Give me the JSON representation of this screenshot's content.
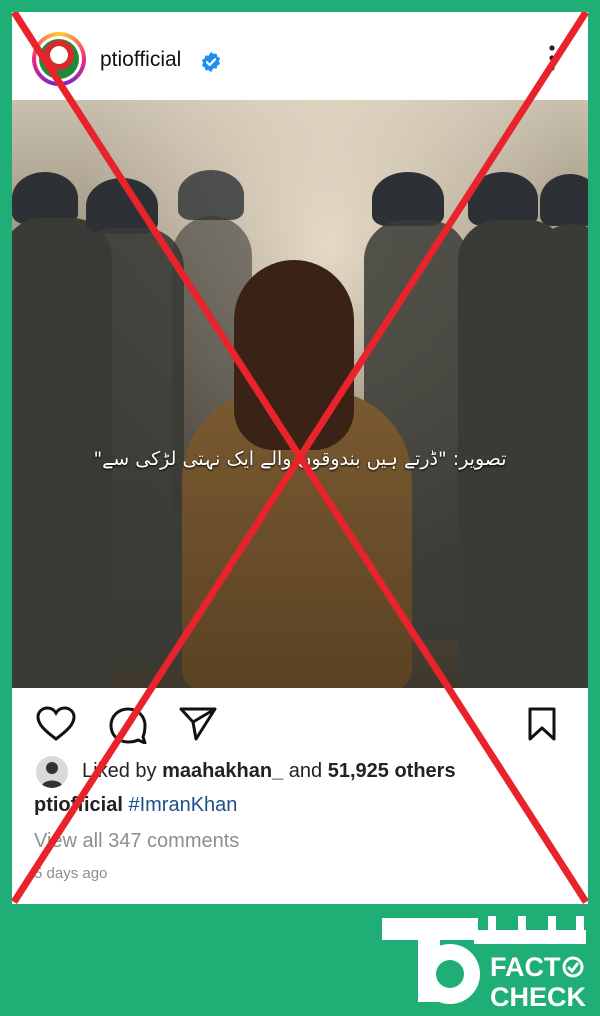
{
  "post": {
    "username": "ptiofficial",
    "image_caption": "تصویر: \"ڈرتے ہیں بندوقوں والے ایک نہتی لڑکی سے\"",
    "likes_prefix": "Liked by",
    "liked_by_user": "maahakhan_",
    "likes_and": "and",
    "likes_others": "51,925 others",
    "caption_user": "ptiofficial",
    "caption_hashtag": "#ImranKhan",
    "comments_link": "View all 347 comments",
    "timestamp": "5 days ago"
  },
  "overlay": {
    "cross_color": "#e8232b",
    "background_color": "#1fae75"
  },
  "brand": {
    "fact": "FACT",
    "check": "CHECK"
  },
  "icons": {
    "verified": "verified-badge-icon",
    "more": "more-options-icon",
    "like": "heart-icon",
    "comment": "comment-bubble-icon",
    "share": "paper-plane-icon",
    "save": "bookmark-icon"
  }
}
